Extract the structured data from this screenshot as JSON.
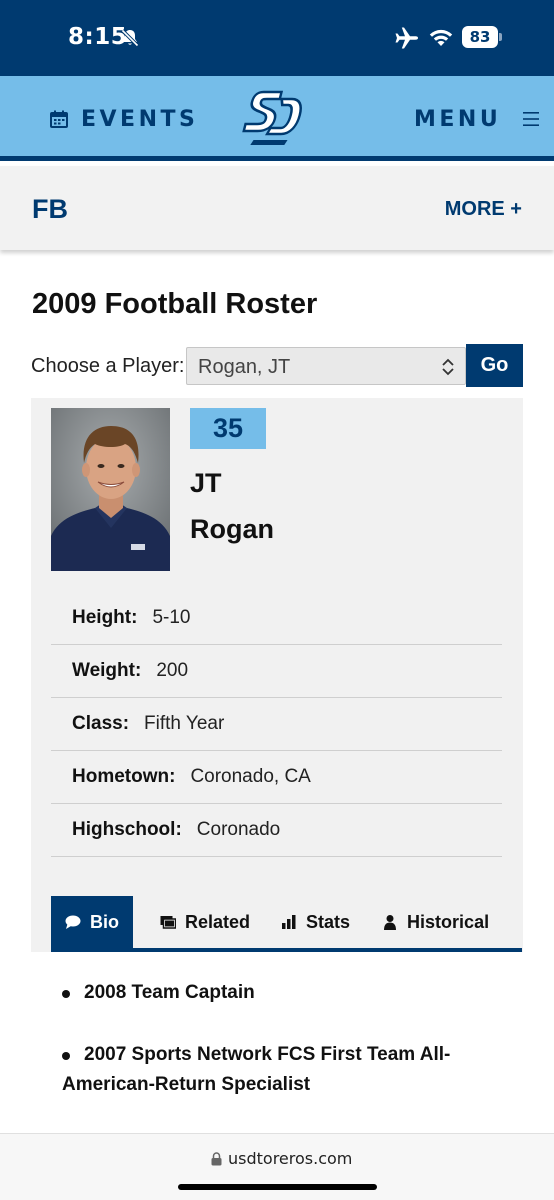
{
  "status_bar": {
    "time": "8:15",
    "battery": "83",
    "icons": [
      "bell-slash-icon",
      "airplane-icon",
      "wifi-icon",
      "battery-icon"
    ]
  },
  "nav": {
    "events_label": "EVENTS",
    "menu_label": "MENU",
    "logo_icon": "sd-logo",
    "calendar_icon": "calendar-icon",
    "menu_icon": "hamburger-icon"
  },
  "sub_nav": {
    "sport": "FB",
    "more": "MORE +"
  },
  "page": {
    "title": "2009 Football Roster"
  },
  "chooser": {
    "label": "Choose a Player:",
    "selected": "Rogan, JT",
    "go_label": "Go"
  },
  "player": {
    "number": "35",
    "first_name": "JT",
    "last_name": "Rogan",
    "info": [
      {
        "key": "Height:",
        "value": "5-10"
      },
      {
        "key": "Weight:",
        "value": "200"
      },
      {
        "key": "Class:",
        "value": "Fifth Year"
      },
      {
        "key": "Hometown:",
        "value": "Coronado, CA"
      },
      {
        "key": "Highschool:",
        "value": "Coronado"
      }
    ]
  },
  "tabs": [
    {
      "label": "Bio",
      "icon": "comment-icon",
      "active": true
    },
    {
      "label": "Related",
      "icon": "images-icon",
      "active": false
    },
    {
      "label": "Stats",
      "icon": "bar-chart-icon",
      "active": false
    },
    {
      "label": "Historical",
      "icon": "user-icon",
      "active": false
    }
  ],
  "bio": {
    "items": [
      "2008 Team Captain",
      "2007 Sports Network FCS First Team All-American-Return Specialist"
    ]
  },
  "browser": {
    "url": "usdtoreros.com"
  },
  "colors": {
    "navy": "#003a70",
    "light_blue": "#75bde9",
    "card_gray": "#f1f1f1"
  }
}
